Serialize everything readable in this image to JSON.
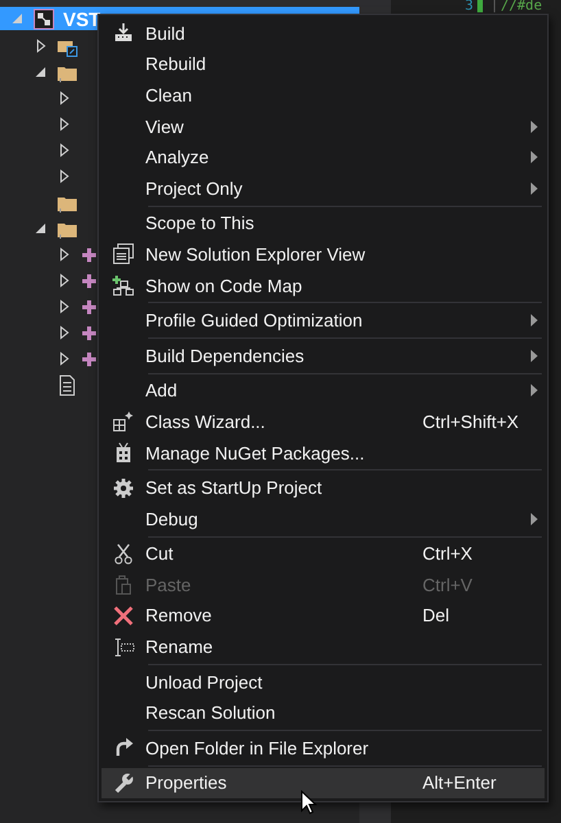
{
  "solution_explorer": {
    "root": {
      "label": "VST",
      "selected": true,
      "expanded": true,
      "children": [
        {
          "kind": "references",
          "expanded": false
        },
        {
          "kind": "folder",
          "expanded": true,
          "children": [
            {
              "expanded": false
            },
            {
              "expanded": false
            },
            {
              "expanded": false
            },
            {
              "expanded": false
            }
          ]
        },
        {
          "kind": "folder"
        },
        {
          "kind": "folder",
          "expanded": true,
          "children": [
            {
              "kind": "source",
              "expanded": false
            },
            {
              "kind": "source",
              "expanded": false
            },
            {
              "kind": "source",
              "expanded": false
            },
            {
              "kind": "source",
              "expanded": false
            },
            {
              "kind": "source",
              "expanded": false
            }
          ]
        },
        {
          "kind": "file"
        }
      ]
    }
  },
  "editor": {
    "line_number": "3",
    "code": "//#de"
  },
  "context_menu": {
    "groups": [
      {
        "items": [
          {
            "label": "Build",
            "kind": "build"
          },
          {
            "label": "Rebuild"
          },
          {
            "label": "Clean"
          },
          {
            "label": "View",
            "submenu": true
          },
          {
            "label": "Analyze",
            "submenu": true
          },
          {
            "label": "Project Only",
            "submenu": true
          }
        ]
      },
      {
        "items": [
          {
            "label": "Scope to This"
          },
          {
            "label": "New Solution Explorer View",
            "kind": "windows"
          },
          {
            "label": "Show on Code Map",
            "kind": "codemap"
          }
        ]
      },
      {
        "items": [
          {
            "label": "Profile Guided Optimization",
            "submenu": true
          }
        ]
      },
      {
        "items": [
          {
            "label": "Build Dependencies",
            "submenu": true
          }
        ]
      },
      {
        "items": [
          {
            "label": "Add",
            "submenu": true
          },
          {
            "label": "Class Wizard...",
            "kind": "wizard",
            "shortcut": "Ctrl+Shift+X"
          },
          {
            "label": "Manage NuGet Packages...",
            "kind": "package"
          }
        ]
      },
      {
        "items": [
          {
            "label": "Set as StartUp Project",
            "kind": "gear"
          },
          {
            "label": "Debug",
            "submenu": true
          }
        ]
      },
      {
        "items": [
          {
            "label": "Cut",
            "kind": "scissors",
            "shortcut": "Ctrl+X"
          },
          {
            "label": "Paste",
            "kind": "paste",
            "shortcut": "Ctrl+V",
            "disabled": true
          },
          {
            "label": "Remove",
            "kind": "remove",
            "shortcut": "Del"
          },
          {
            "label": "Rename",
            "kind": "rename"
          }
        ]
      },
      {
        "items": [
          {
            "label": "Unload Project"
          },
          {
            "label": "Rescan Solution"
          }
        ]
      },
      {
        "items": [
          {
            "label": "Open Folder in File Explorer",
            "kind": "openfolder"
          }
        ]
      },
      {
        "items": [
          {
            "label": "Properties",
            "kind": "wrench",
            "shortcut": "Alt+Enter",
            "selected": true
          }
        ]
      }
    ]
  }
}
